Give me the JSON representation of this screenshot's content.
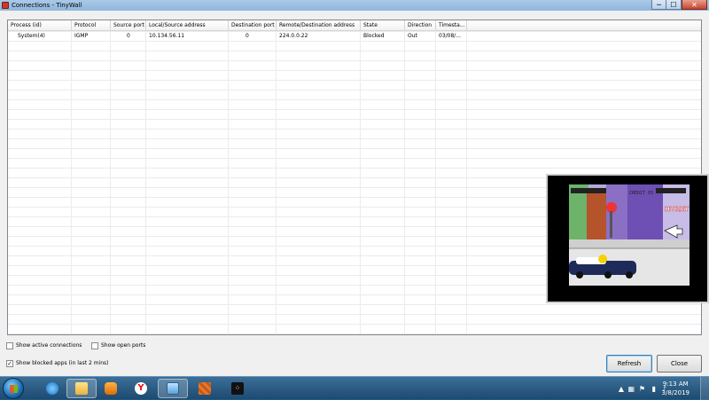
{
  "window": {
    "title": "Connections - TinyWall",
    "min_label": "─",
    "max_label": "☐",
    "close_label": "✕"
  },
  "table": {
    "columns": [
      "Process (id)",
      "Protocol",
      "Source port",
      "Local/Source address",
      "Destination port",
      "Remote/Destination address",
      "State",
      "Direction",
      "Timesta..."
    ],
    "rows": [
      [
        "System(4)",
        "IGMP",
        "0",
        "10.134.56.11",
        "0",
        "224.0.0.22",
        "Blocked",
        "Out",
        "03/08/..."
      ]
    ]
  },
  "options": {
    "show_active": {
      "label": "Show active connections",
      "checked": false
    },
    "show_open_ports": {
      "label": "Show open ports",
      "checked": false
    },
    "show_blocked": {
      "label": "Show blocked apps (in last 2 mins)",
      "checked": true
    }
  },
  "buttons": {
    "refresh": "Refresh",
    "close": "Close"
  },
  "taskbar": {
    "items": [
      "folder-icon",
      "media-player-icon",
      "yandex-browser-icon",
      "explorer-window-icon",
      "game-icon",
      "blackberry-icon"
    ],
    "time": "9:13 AM",
    "date": "3/8/2019"
  },
  "overlay_game": {
    "credit_text": "CREDIT 03",
    "hurry_text": "HURRY UP",
    "sign_text": "STOP"
  }
}
